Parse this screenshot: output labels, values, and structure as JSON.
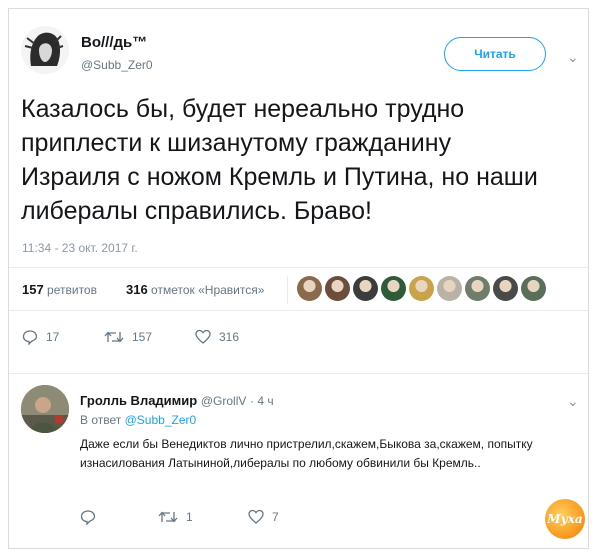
{
  "tweet": {
    "name": "Во///дь™",
    "handle": "@Subb_Zer0",
    "follow_label": "Читать",
    "text": "Казалось бы, будет нереально трудно приплести к шизанутому гражданину Израиля с ножом Кремль и Путина, но наши либералы справились. Браво!",
    "timestamp": "11:34 - 23 окт. 2017 г."
  },
  "stats": {
    "retweets_count": "157",
    "retweets_label": "ретвитов",
    "likes_count": "316",
    "likes_label": "отметок «Нравится»"
  },
  "likers": [
    "#8a6a4a",
    "#6d4c3b",
    "#3c3c3c",
    "#2e5c3a",
    "#c9a24a",
    "#b9b2a6",
    "#6f7d6a",
    "#4a4a4a",
    "#5a6e5a"
  ],
  "actions": {
    "replies": "17",
    "retweets": "157",
    "likes": "316"
  },
  "reply": {
    "name": "Гролль Владимир",
    "handle": "@GrollV",
    "time": "· 4 ч",
    "in_reply_prefix": "В ответ",
    "in_reply_handle": "@Subb_Zer0",
    "text": "Даже если бы Венедиктов лично пристрелил,скажем,Быкова за,скажем, попытку изнасилования Латыниной,либералы по любому обвинили бы Кремль..",
    "replies": "",
    "retweets": "1",
    "likes": "7"
  },
  "watermark": "Муха",
  "colors": {
    "accent": "#1da1f2",
    "muted": "#657786"
  }
}
